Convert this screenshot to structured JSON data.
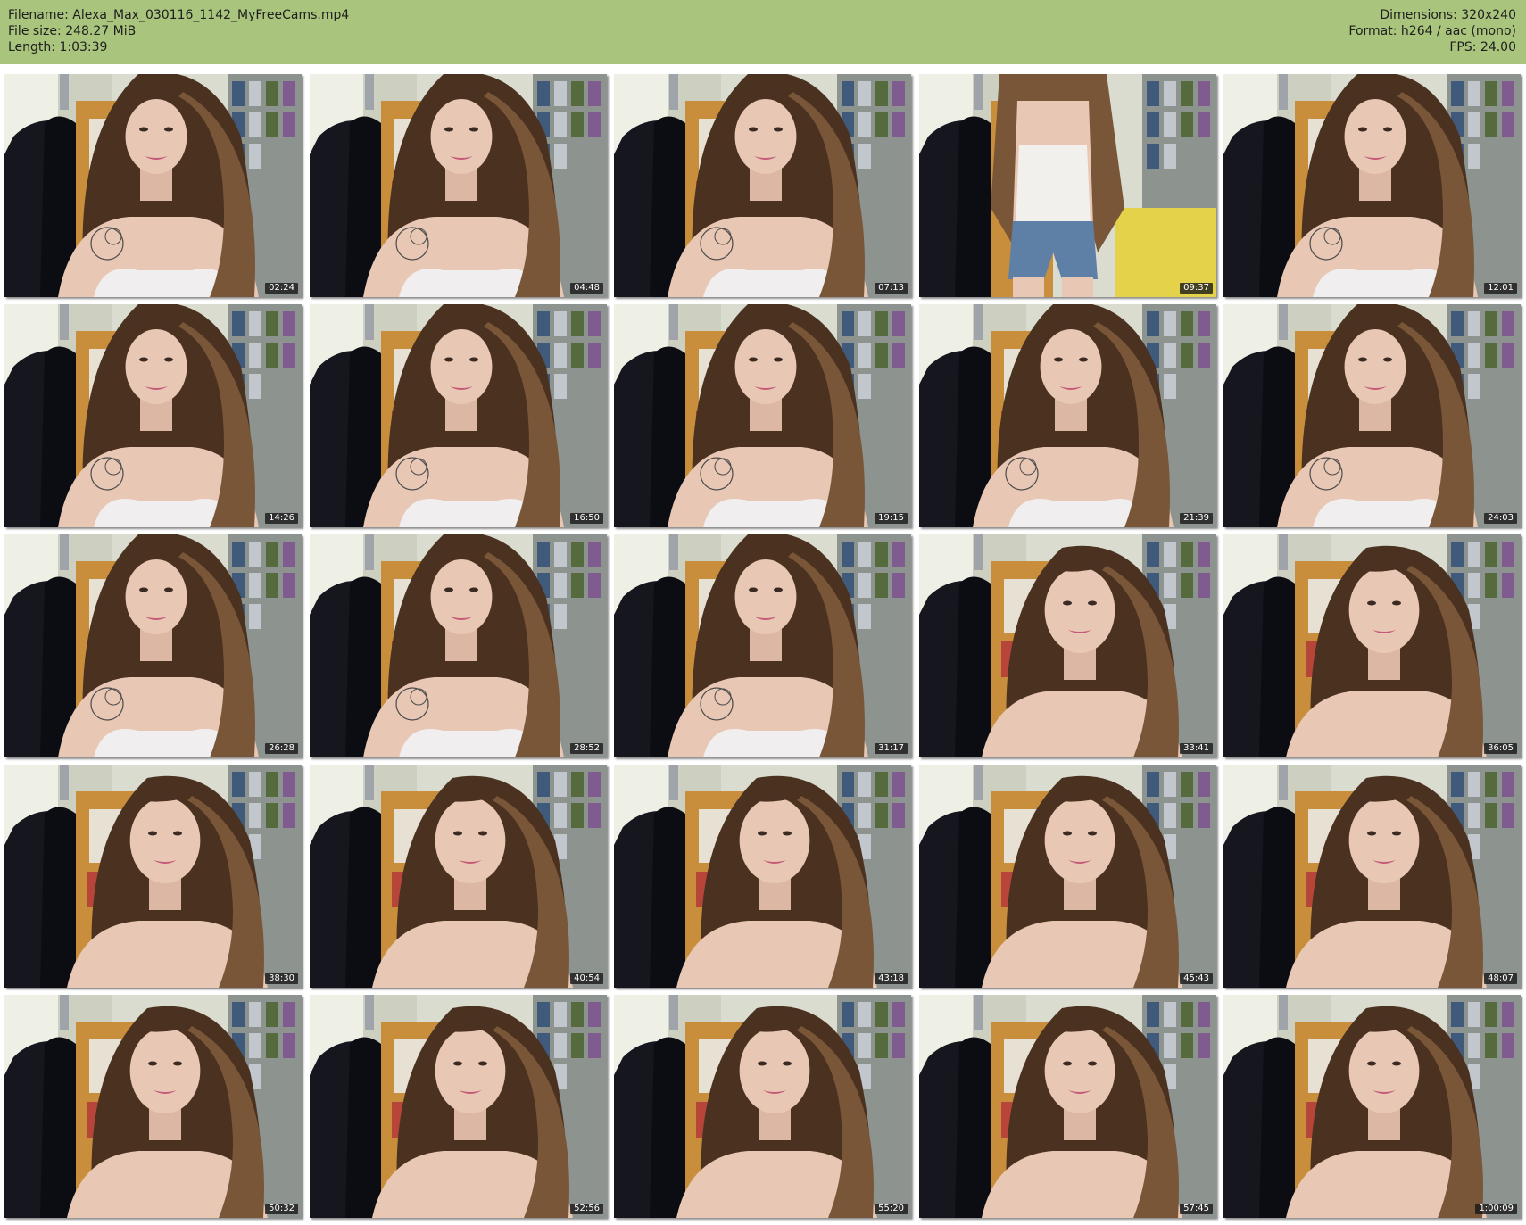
{
  "info": {
    "filename": "Filename: Alexa_Max_030116_1142_MyFreeCams.mp4",
    "filesize": "File size: 248.27 MiB",
    "length": "Length: 1:03:39",
    "dimensions": "Dimensions: 320x240",
    "format": "Format: h264 / aac (mono)",
    "fps": "FPS: 24.00"
  },
  "colors": {
    "header_bg": "#a9c47c",
    "page_bg": "#ffffff",
    "timestamp_bg": "#141414"
  },
  "thumbnails": [
    {
      "timestamp": "02:24",
      "subject": "face-close"
    },
    {
      "timestamp": "04:48",
      "subject": "chin-tank"
    },
    {
      "timestamp": "07:13",
      "subject": "face-close"
    },
    {
      "timestamp": "09:37",
      "subject": "standing-shorts"
    },
    {
      "timestamp": "12:01",
      "subject": "face-close"
    },
    {
      "timestamp": "14:26",
      "subject": "face-close"
    },
    {
      "timestamp": "16:50",
      "subject": "face-close"
    },
    {
      "timestamp": "19:15",
      "subject": "face-close"
    },
    {
      "timestamp": "21:39",
      "subject": "face-close"
    },
    {
      "timestamp": "24:03",
      "subject": "face-close"
    },
    {
      "timestamp": "26:28",
      "subject": "face-close"
    },
    {
      "timestamp": "28:52",
      "subject": "face-close"
    },
    {
      "timestamp": "31:17",
      "subject": "face-close"
    },
    {
      "timestamp": "33:41",
      "subject": "face-near"
    },
    {
      "timestamp": "36:05",
      "subject": "face-near"
    },
    {
      "timestamp": "38:30",
      "subject": "face-near"
    },
    {
      "timestamp": "40:54",
      "subject": "face-near"
    },
    {
      "timestamp": "43:18",
      "subject": "face-near"
    },
    {
      "timestamp": "45:43",
      "subject": "face-near"
    },
    {
      "timestamp": "48:07",
      "subject": "face-near"
    },
    {
      "timestamp": "50:32",
      "subject": "face-near"
    },
    {
      "timestamp": "52:56",
      "subject": "face-near"
    },
    {
      "timestamp": "55:20",
      "subject": "face-near"
    },
    {
      "timestamp": "57:45",
      "subject": "face-near"
    },
    {
      "timestamp": "1:00:09",
      "subject": "face-near"
    }
  ]
}
